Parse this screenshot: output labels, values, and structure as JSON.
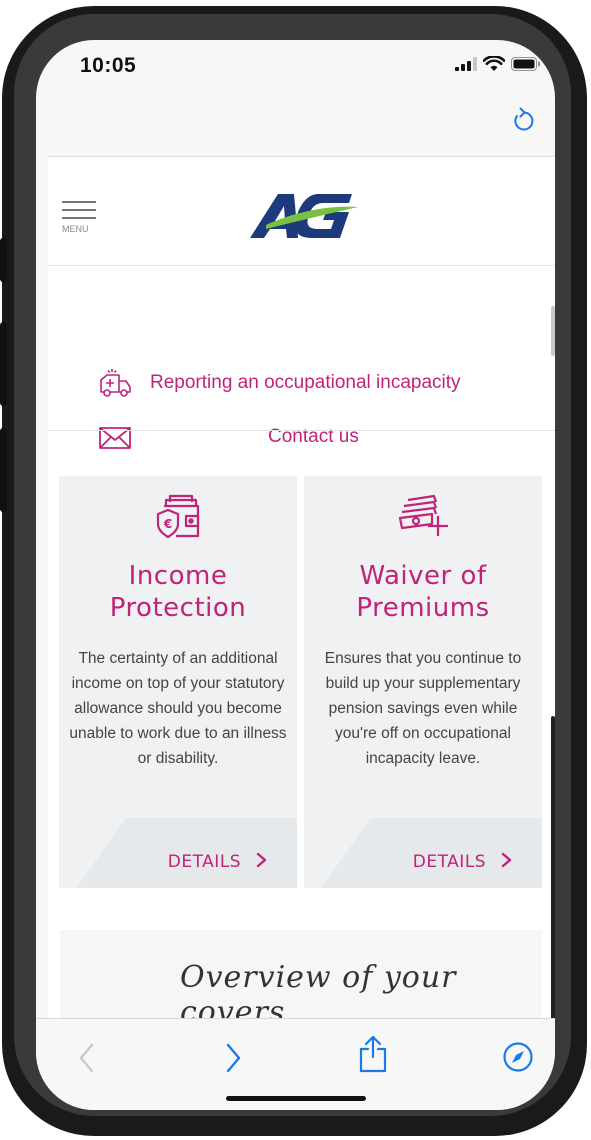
{
  "status_bar": {
    "time": "10:05"
  },
  "header": {
    "menu_label": "MENU",
    "logo_text": "AG"
  },
  "quick_links": [
    {
      "label": "Reporting an occupational incapacity",
      "icon": "ambulance-icon"
    },
    {
      "label": "Contact us",
      "icon": "envelope-icon"
    }
  ],
  "cards": [
    {
      "title_line1": "Income",
      "title_line2": "Protection",
      "description": "The certainty of an additional income on top of your statutory allowance should you become unable to work due to an illness or disability.",
      "cta": "DETAILS",
      "icon": "wallet-shield-icon"
    },
    {
      "title_line1": "Waiver of",
      "title_line2": "Premiums",
      "description": "Ensures that you continue to build up your supplementary pension savings even while you're off on occupational incapacity leave.",
      "cta": "DETAILS",
      "icon": "money-stack-plus-icon"
    }
  ],
  "overview": {
    "title": "Overview of your covers"
  },
  "colors": {
    "accent": "#c0237a",
    "link_blue": "#1a7ae6",
    "logo_navy": "#1d3a7d",
    "logo_green": "#7ac143"
  }
}
